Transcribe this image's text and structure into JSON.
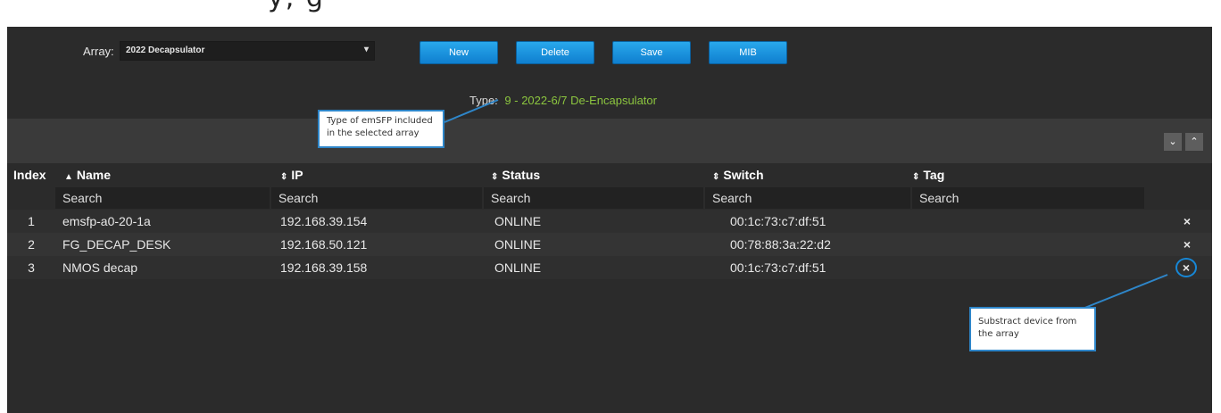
{
  "colors": {
    "accent": "#1591e0",
    "type_value": "#8cc63f",
    "delete": "#d62b2b",
    "callout_border": "#2e86c9"
  },
  "header_fragment": "y,                                                        g",
  "toolbar": {
    "array_label": "Array:",
    "array_value": "2022 Decapsulator",
    "buttons": {
      "new": "New",
      "delete": "Delete",
      "save": "Save",
      "mib": "MIB"
    },
    "type_label": "Type:",
    "type_value": "9 - 2022-6/7 De-Encapsulator"
  },
  "band": {
    "collapse_icon": "chevron-down-icon",
    "expand_icon": "chevron-up-icon"
  },
  "table": {
    "headers": {
      "index": "Index",
      "name": "Name",
      "ip": "IP",
      "status": "Status",
      "switch": "Switch",
      "tag": "Tag"
    },
    "search_placeholder": "Search",
    "rows": [
      {
        "index": "1",
        "name": "emsfp-a0-20-1a",
        "ip": "192.168.39.154",
        "status": "ONLINE",
        "switch": "00:1c:73:c7:df:51",
        "tag": ""
      },
      {
        "index": "2",
        "name": "FG_DECAP_DESK",
        "ip": "192.168.50.121",
        "status": "ONLINE",
        "switch": "00:78:88:3a:22:d2",
        "tag": ""
      },
      {
        "index": "3",
        "name": "NMOS decap",
        "ip": "192.168.39.158",
        "status": "ONLINE",
        "switch": "00:1c:73:c7:df:51",
        "tag": ""
      }
    ],
    "delete_glyph": "×"
  },
  "callouts": {
    "type_note": [
      "Type of emSFP included",
      "in the selected array"
    ],
    "delete_note": [
      "Substract device from",
      "the array"
    ]
  }
}
